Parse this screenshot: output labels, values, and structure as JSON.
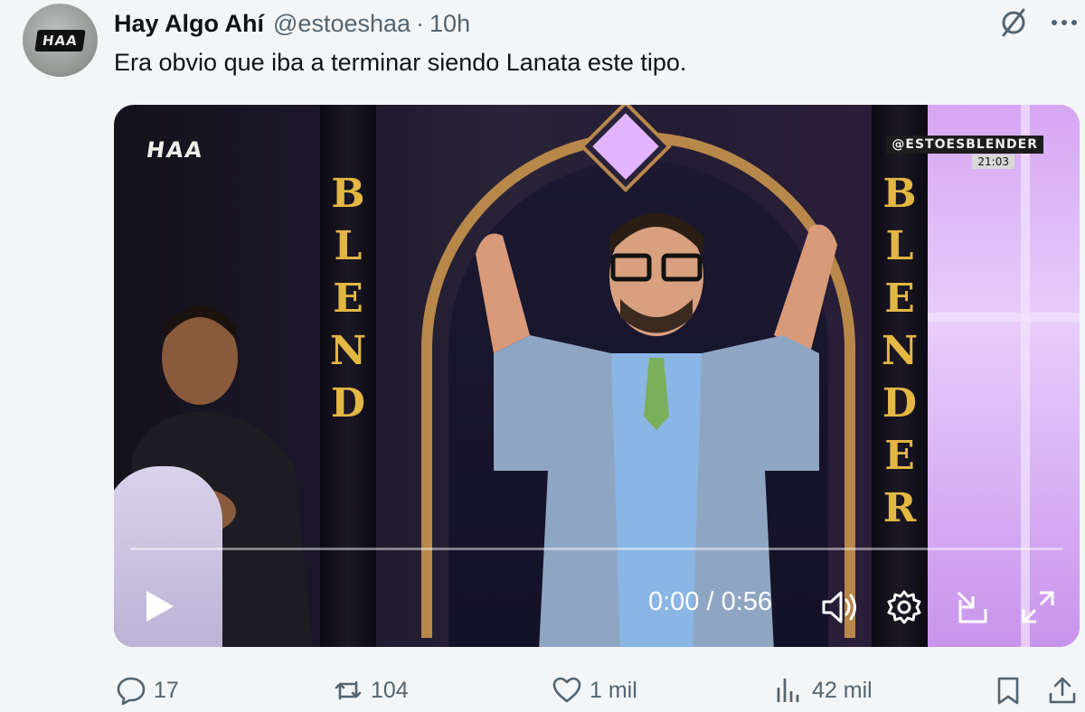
{
  "tweet": {
    "avatar_label": "HAA",
    "display_name": "Hay Algo Ahí",
    "handle": "@estoeshaa",
    "separator": "·",
    "time": "10h",
    "text": "Era obvio que iba a terminar siendo Lanata este tipo."
  },
  "video": {
    "logo": "HAA",
    "watermark": "@ESTOESBLENDER",
    "watermark_time": "21:03",
    "pillar_left": [
      "B",
      "L",
      "E",
      "N",
      "D"
    ],
    "pillar_right": [
      "B",
      "L",
      "E",
      "N",
      "D",
      "E",
      "R"
    ],
    "current_time": "0:00",
    "duration": "0:56",
    "time_display": "0:00 / 0:56",
    "progress_fraction": 0.0
  },
  "actions": {
    "replies": "17",
    "reposts": "104",
    "likes": "1 mil",
    "views": "42 mil"
  },
  "icons": {
    "header": [
      "grok-icon",
      "more-icon"
    ],
    "controls": [
      "play-icon",
      "volume-icon",
      "settings-icon",
      "pip-icon",
      "fullscreen-icon"
    ],
    "actions": [
      "reply-icon",
      "repost-icon",
      "like-icon",
      "views-icon",
      "bookmark-icon",
      "share-icon"
    ]
  },
  "colors": {
    "text": "#0f1419",
    "muted": "#536471",
    "background": "#f4f5f6",
    "accent_gold": "#e3b743"
  }
}
